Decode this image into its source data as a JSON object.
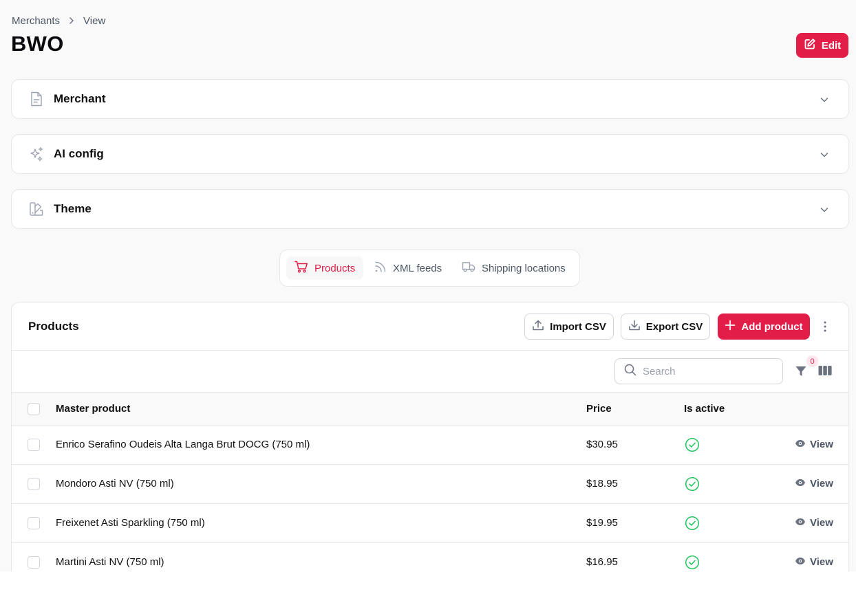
{
  "breadcrumb": {
    "parent": "Merchants",
    "current": "View"
  },
  "page": {
    "title": "BWO",
    "edit_label": "Edit"
  },
  "sections": [
    {
      "title": "Merchant",
      "icon": "document-icon"
    },
    {
      "title": "AI config",
      "icon": "sparkles-icon"
    },
    {
      "title": "Theme",
      "icon": "swatch-icon"
    }
  ],
  "tabs": [
    {
      "label": "Products",
      "icon": "cart-icon",
      "active": true
    },
    {
      "label": "XML feeds",
      "icon": "rss-icon",
      "active": false
    },
    {
      "label": "Shipping locations",
      "icon": "truck-icon",
      "active": false
    }
  ],
  "products": {
    "title": "Products",
    "import_label": "Import CSV",
    "export_label": "Export CSV",
    "add_label": "Add product",
    "search_placeholder": "Search",
    "filter_count": "0",
    "columns": {
      "product": "Master product",
      "price": "Price",
      "active": "Is active"
    },
    "view_label": "View",
    "rows": [
      {
        "name": "Enrico Serafino Oudeis Alta Langa Brut DOCG (750 ml)",
        "price": "$30.95",
        "active": true
      },
      {
        "name": "Mondoro Asti NV (750 ml)",
        "price": "$18.95",
        "active": true
      },
      {
        "name": "Freixenet Asti Sparkling (750 ml)",
        "price": "$19.95",
        "active": true
      },
      {
        "name": "Martini Asti NV (750 ml)",
        "price": "$16.95",
        "active": true
      }
    ]
  },
  "colors": {
    "accent": "#e11d48",
    "success": "#22c55e"
  }
}
